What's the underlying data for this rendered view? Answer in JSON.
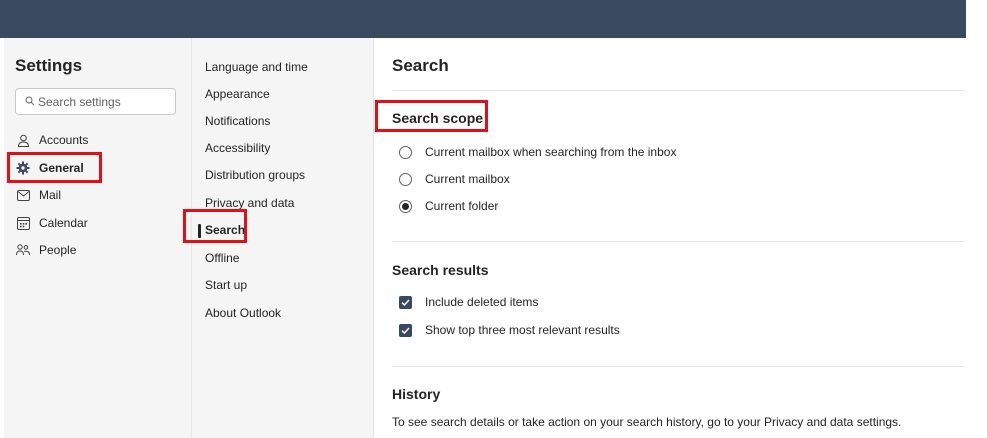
{
  "settings": {
    "title": "Settings",
    "search_placeholder": "Search settings"
  },
  "nav": {
    "items": [
      {
        "label": "Accounts",
        "icon": "person-icon"
      },
      {
        "label": "General",
        "icon": "gear-icon",
        "active": true
      },
      {
        "label": "Mail",
        "icon": "mail-icon"
      },
      {
        "label": "Calendar",
        "icon": "calendar-icon"
      },
      {
        "label": "People",
        "icon": "people-icon"
      }
    ]
  },
  "subnav": {
    "items": [
      {
        "label": "Language and time"
      },
      {
        "label": "Appearance"
      },
      {
        "label": "Notifications"
      },
      {
        "label": "Accessibility"
      },
      {
        "label": "Distribution groups"
      },
      {
        "label": "Privacy and data"
      },
      {
        "label": "Search",
        "active": true
      },
      {
        "label": "Offline"
      },
      {
        "label": "Start up"
      },
      {
        "label": "About Outlook"
      }
    ]
  },
  "main": {
    "title": "Search",
    "scope": {
      "title": "Search scope",
      "options": [
        {
          "label": "Current mailbox when searching from the inbox",
          "checked": false
        },
        {
          "label": "Current mailbox",
          "checked": false
        },
        {
          "label": "Current folder",
          "checked": true
        }
      ]
    },
    "results": {
      "title": "Search results",
      "options": [
        {
          "label": "Include deleted items",
          "checked": true
        },
        {
          "label": "Show top three most relevant results",
          "checked": true
        }
      ]
    },
    "history": {
      "title": "History",
      "text": "To see search details or take action on your search history, go to your Privacy and data settings."
    }
  },
  "colors": {
    "topbar": "#374a5e",
    "highlight": "#e0101a",
    "checkbox": "#374a5e"
  }
}
